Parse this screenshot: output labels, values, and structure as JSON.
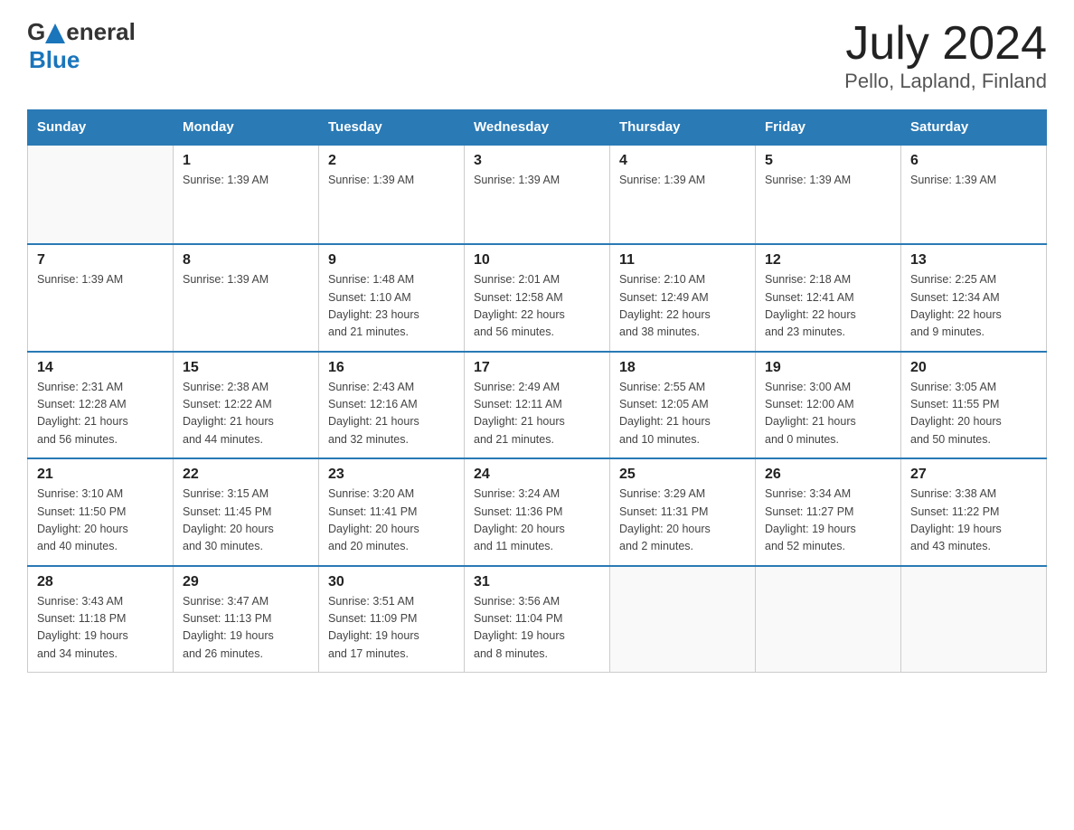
{
  "header": {
    "logo_text_general": "General",
    "logo_text_blue": "Blue",
    "month_year": "July 2024",
    "location": "Pello, Lapland, Finland"
  },
  "calendar": {
    "days_of_week": [
      "Sunday",
      "Monday",
      "Tuesday",
      "Wednesday",
      "Thursday",
      "Friday",
      "Saturday"
    ],
    "weeks": [
      {
        "days": [
          {
            "num": "",
            "info": "",
            "empty": true
          },
          {
            "num": "1",
            "info": "Sunrise: 1:39 AM"
          },
          {
            "num": "2",
            "info": "Sunrise: 1:39 AM"
          },
          {
            "num": "3",
            "info": "Sunrise: 1:39 AM"
          },
          {
            "num": "4",
            "info": "Sunrise: 1:39 AM"
          },
          {
            "num": "5",
            "info": "Sunrise: 1:39 AM"
          },
          {
            "num": "6",
            "info": "Sunrise: 1:39 AM"
          }
        ]
      },
      {
        "days": [
          {
            "num": "7",
            "info": "Sunrise: 1:39 AM"
          },
          {
            "num": "8",
            "info": "Sunrise: 1:39 AM"
          },
          {
            "num": "9",
            "info": "Sunrise: 1:48 AM\nSunset: 1:10 AM\nDaylight: 23 hours\nand 21 minutes."
          },
          {
            "num": "10",
            "info": "Sunrise: 2:01 AM\nSunset: 12:58 AM\nDaylight: 22 hours\nand 56 minutes."
          },
          {
            "num": "11",
            "info": "Sunrise: 2:10 AM\nSunset: 12:49 AM\nDaylight: 22 hours\nand 38 minutes."
          },
          {
            "num": "12",
            "info": "Sunrise: 2:18 AM\nSunset: 12:41 AM\nDaylight: 22 hours\nand 23 minutes."
          },
          {
            "num": "13",
            "info": "Sunrise: 2:25 AM\nSunset: 12:34 AM\nDaylight: 22 hours\nand 9 minutes."
          }
        ]
      },
      {
        "days": [
          {
            "num": "14",
            "info": "Sunrise: 2:31 AM\nSunset: 12:28 AM\nDaylight: 21 hours\nand 56 minutes."
          },
          {
            "num": "15",
            "info": "Sunrise: 2:38 AM\nSunset: 12:22 AM\nDaylight: 21 hours\nand 44 minutes."
          },
          {
            "num": "16",
            "info": "Sunrise: 2:43 AM\nSunset: 12:16 AM\nDaylight: 21 hours\nand 32 minutes."
          },
          {
            "num": "17",
            "info": "Sunrise: 2:49 AM\nSunset: 12:11 AM\nDaylight: 21 hours\nand 21 minutes."
          },
          {
            "num": "18",
            "info": "Sunrise: 2:55 AM\nSunset: 12:05 AM\nDaylight: 21 hours\nand 10 minutes."
          },
          {
            "num": "19",
            "info": "Sunrise: 3:00 AM\nSunset: 12:00 AM\nDaylight: 21 hours\nand 0 minutes."
          },
          {
            "num": "20",
            "info": "Sunrise: 3:05 AM\nSunset: 11:55 PM\nDaylight: 20 hours\nand 50 minutes."
          }
        ]
      },
      {
        "days": [
          {
            "num": "21",
            "info": "Sunrise: 3:10 AM\nSunset: 11:50 PM\nDaylight: 20 hours\nand 40 minutes."
          },
          {
            "num": "22",
            "info": "Sunrise: 3:15 AM\nSunset: 11:45 PM\nDaylight: 20 hours\nand 30 minutes."
          },
          {
            "num": "23",
            "info": "Sunrise: 3:20 AM\nSunset: 11:41 PM\nDaylight: 20 hours\nand 20 minutes."
          },
          {
            "num": "24",
            "info": "Sunrise: 3:24 AM\nSunset: 11:36 PM\nDaylight: 20 hours\nand 11 minutes."
          },
          {
            "num": "25",
            "info": "Sunrise: 3:29 AM\nSunset: 11:31 PM\nDaylight: 20 hours\nand 2 minutes."
          },
          {
            "num": "26",
            "info": "Sunrise: 3:34 AM\nSunset: 11:27 PM\nDaylight: 19 hours\nand 52 minutes."
          },
          {
            "num": "27",
            "info": "Sunrise: 3:38 AM\nSunset: 11:22 PM\nDaylight: 19 hours\nand 43 minutes."
          }
        ]
      },
      {
        "days": [
          {
            "num": "28",
            "info": "Sunrise: 3:43 AM\nSunset: 11:18 PM\nDaylight: 19 hours\nand 34 minutes."
          },
          {
            "num": "29",
            "info": "Sunrise: 3:47 AM\nSunset: 11:13 PM\nDaylight: 19 hours\nand 26 minutes."
          },
          {
            "num": "30",
            "info": "Sunrise: 3:51 AM\nSunset: 11:09 PM\nDaylight: 19 hours\nand 17 minutes."
          },
          {
            "num": "31",
            "info": "Sunrise: 3:56 AM\nSunset: 11:04 PM\nDaylight: 19 hours\nand 8 minutes."
          },
          {
            "num": "",
            "info": "",
            "empty": true
          },
          {
            "num": "",
            "info": "",
            "empty": true
          },
          {
            "num": "",
            "info": "",
            "empty": true
          }
        ]
      }
    ]
  }
}
